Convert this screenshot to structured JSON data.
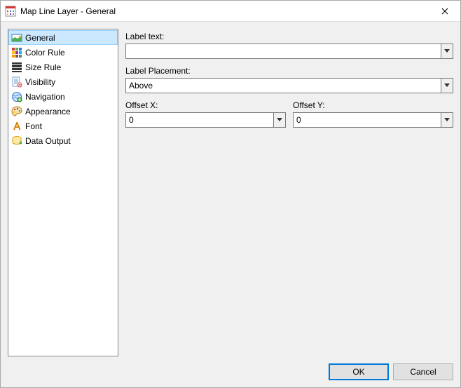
{
  "window": {
    "title": "Map Line Layer - General"
  },
  "sidebar": {
    "items": [
      {
        "label": "General"
      },
      {
        "label": "Color Rule"
      },
      {
        "label": "Size Rule"
      },
      {
        "label": "Visibility"
      },
      {
        "label": "Navigation"
      },
      {
        "label": "Appearance"
      },
      {
        "label": "Font"
      },
      {
        "label": "Data Output"
      }
    ]
  },
  "main": {
    "labelText": {
      "label": "Label text:",
      "value": ""
    },
    "labelPlacement": {
      "label": "Label Placement:",
      "value": "Above"
    },
    "offsetX": {
      "label": "Offset X:",
      "value": "0"
    },
    "offsetY": {
      "label": "Offset Y:",
      "value": "0"
    }
  },
  "buttons": {
    "ok": "OK",
    "cancel": "Cancel"
  }
}
